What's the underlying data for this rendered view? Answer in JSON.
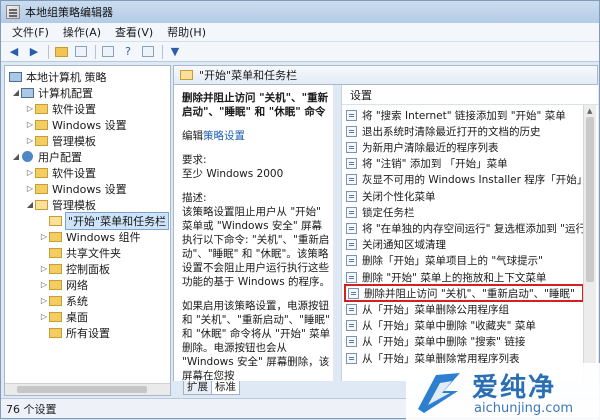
{
  "window": {
    "title": "本地组策略编辑器"
  },
  "menubar": {
    "items": [
      "文件(F)",
      "操作(A)",
      "查看(V)",
      "帮助(H)"
    ]
  },
  "toolbar": {
    "icons": [
      "back-arrow-icon",
      "forward-arrow-icon",
      "up-folder-icon",
      "show-hide-tree-icon",
      "export-list-icon",
      "help-icon",
      "properties-icon",
      "filter-icon"
    ]
  },
  "tree": {
    "items": [
      {
        "label": "本地计算机 策略",
        "icon": "computer-policy-icon",
        "level": 0,
        "expander": ""
      },
      {
        "label": "计算机配置",
        "icon": "computer-icon",
        "level": 1,
        "expander": "◢"
      },
      {
        "label": "软件设置",
        "icon": "folder-icon",
        "level": 2,
        "expander": "▷"
      },
      {
        "label": "Windows 设置",
        "icon": "folder-icon",
        "level": 2,
        "expander": "▷"
      },
      {
        "label": "管理模板",
        "icon": "folder-icon",
        "level": 2,
        "expander": "▷"
      },
      {
        "label": "用户配置",
        "icon": "user-icon",
        "level": 1,
        "expander": "◢"
      },
      {
        "label": "软件设置",
        "icon": "folder-icon",
        "level": 2,
        "expander": "▷"
      },
      {
        "label": "Windows 设置",
        "icon": "folder-icon",
        "level": 2,
        "expander": "▷"
      },
      {
        "label": "管理模板",
        "icon": "folder-icon",
        "level": 2,
        "expander": "◢"
      },
      {
        "label": "\"开始\"菜单和任务栏",
        "icon": "folder-open-icon",
        "level": 3,
        "expander": "",
        "selected": true
      },
      {
        "label": "Windows 组件",
        "icon": "folder-icon",
        "level": 3,
        "expander": "▷"
      },
      {
        "label": "共享文件夹",
        "icon": "folder-icon",
        "level": 3,
        "expander": ""
      },
      {
        "label": "控制面板",
        "icon": "folder-icon",
        "level": 3,
        "expander": "▷"
      },
      {
        "label": "网络",
        "icon": "folder-icon",
        "level": 3,
        "expander": "▷"
      },
      {
        "label": "系统",
        "icon": "folder-icon",
        "level": 3,
        "expander": "▷"
      },
      {
        "label": "桌面",
        "icon": "folder-icon",
        "level": 3,
        "expander": "▷"
      },
      {
        "label": "所有设置",
        "icon": "folder-icon",
        "level": 3,
        "expander": ""
      }
    ]
  },
  "header": {
    "title": "\"开始\"菜单和任务栏"
  },
  "description": {
    "title": "删除并阻止访问 \"关机\"、\"重新启动\"、\"睡眠\" 和 \"休眠\" 命令",
    "edit_prefix": "编辑",
    "edit_link": "策略设置",
    "req_label": "要求:",
    "req_value": "至少 Windows 2000",
    "desc_label": "描述:",
    "desc_text1": "该策略设置阻止用户从 \"开始\" 菜单或 \"Windows 安全\" 屏幕执行以下命令: \"关机\"、\"重新启动\"、\"睡眠\" 和 \"休眠\"。该策略设置不会阻止用户运行执行这些功能的基于 Windows 的程序。",
    "desc_text2": "如果启用该策略设置，电源按钮和 \"关机\"、\"重新启动\"、\"睡眠\" 和 \"休眠\" 命令将从 \"开始\" 菜单删除。电源按钮也会从 \"Windows 安全\" 屏幕删除，该屏幕在您按 CTRL+ALT+DELETE 时"
  },
  "settings": {
    "column": "设置",
    "rows": [
      "将 \"搜索 Internet\" 链接添加到 \"开始\" 菜单",
      "退出系统时清除最近打开的文档的历史",
      "为新用户清除最近的程序列表",
      "将 \"注销\" 添加到 「开始」菜单",
      "灰显不可用的 Windows Installer 程序「开始」菜单",
      "关闭个性化菜单",
      "锁定任务栏",
      "将 \"在单独的内存空间运行\" 复选框添加到 \"运行\" 对",
      "关闭通知区域清理",
      "删除「开始」菜单项目上的 \"气球提示\"",
      "删除 \"开始\" 菜单上的拖放和上下文菜单",
      "删除并阻止访问 \"关机\"、\"重新启动\"、\"睡眠\"",
      "从「开始」菜单删除公用程序组",
      "从「开始」菜单中删除 \"收藏夹\" 菜单",
      "从「开始」菜单中删除 \"搜索\" 链接",
      "从「开始」菜单删除常用程序列表"
    ],
    "highlighted_index": 11,
    "highlight_color": "#d42020"
  },
  "tabs": {
    "items": [
      "扩展",
      "标准"
    ],
    "active": 1
  },
  "status": {
    "text": "76 个设置"
  },
  "watermark": {
    "brand": "爱纯净",
    "url": "aichunjing.com"
  }
}
